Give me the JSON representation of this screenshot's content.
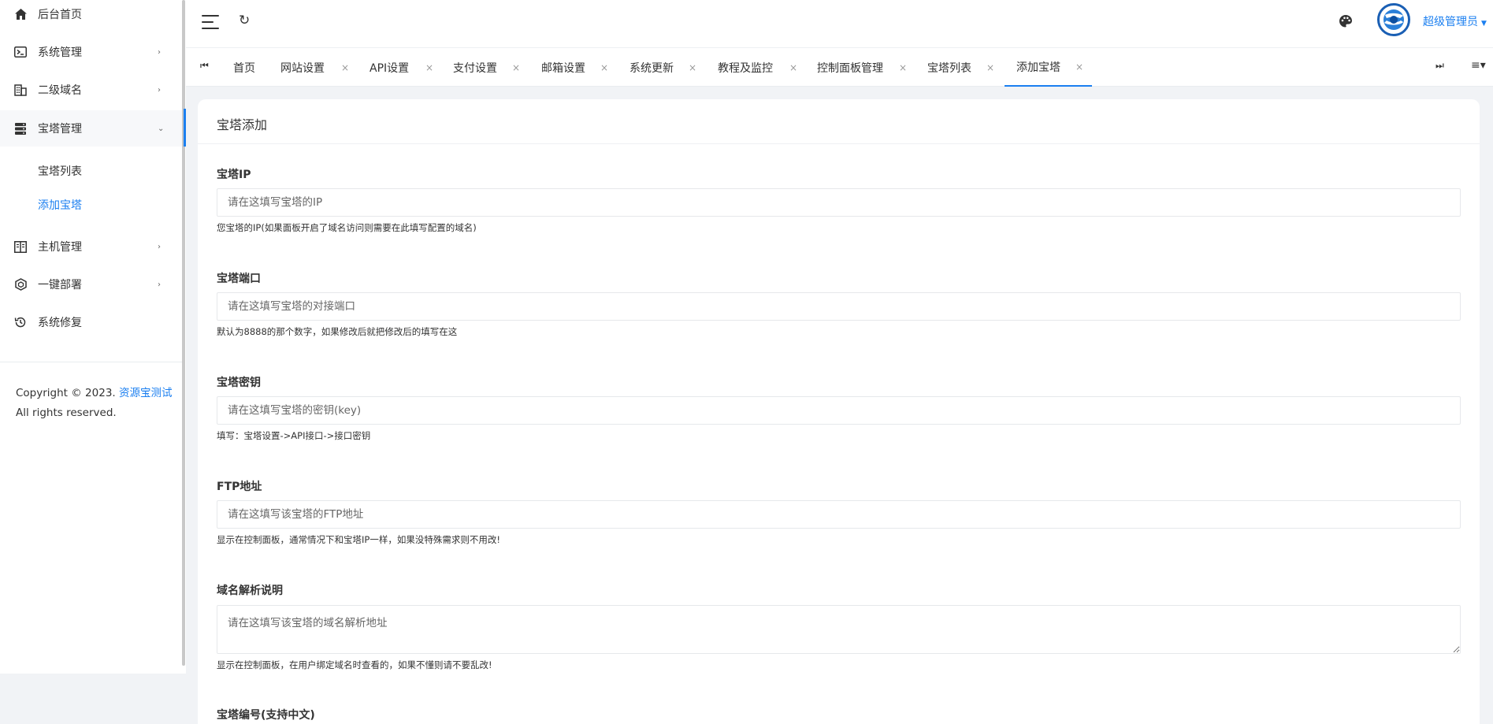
{
  "sidebar": {
    "items": [
      {
        "label": "后台首页",
        "icon": "home-icon"
      },
      {
        "label": "系统管理",
        "icon": "terminal-icon",
        "chevron": "›"
      },
      {
        "label": "二级域名",
        "icon": "building-icon",
        "chevron": "›"
      },
      {
        "label": "宝塔管理",
        "icon": "server-icon",
        "chevron": "⌄"
      },
      {
        "label": "主机管理",
        "icon": "columns-icon",
        "chevron": "›"
      },
      {
        "label": "一键部署",
        "icon": "hexagon-icon",
        "chevron": "›"
      },
      {
        "label": "系统修复",
        "icon": "history-icon"
      }
    ],
    "subitems": [
      {
        "label": "宝塔列表"
      },
      {
        "label": "添加宝塔"
      }
    ],
    "copyright_prefix": "Copyright © 2023. ",
    "copyright_link": "资源宝测试",
    "copyright_suffix": "All rights reserved."
  },
  "header": {
    "user": "超级管理员",
    "caret": "▼",
    "refresh": "↻"
  },
  "tabs": {
    "first": "⏮",
    "last": "⏭",
    "menu": "≡▾",
    "close": "×",
    "items": [
      {
        "label": "首页"
      },
      {
        "label": "网站设置"
      },
      {
        "label": "API设置"
      },
      {
        "label": "支付设置"
      },
      {
        "label": "邮箱设置"
      },
      {
        "label": "系统更新"
      },
      {
        "label": "教程及监控"
      },
      {
        "label": "控制面板管理"
      },
      {
        "label": "宝塔列表"
      },
      {
        "label": "添加宝塔"
      }
    ]
  },
  "form": {
    "title": "宝塔添加",
    "fields": [
      {
        "label": "宝塔IP",
        "placeholder": "请在这填写宝塔的IP",
        "help": "您宝塔的IP(如果面板开启了域名访问则需要在此填写配置的域名)"
      },
      {
        "label": "宝塔端口",
        "placeholder": "请在这填写宝塔的对接端口",
        "help": "默认为8888的那个数字，如果修改后就把修改后的填写在这"
      },
      {
        "label": "宝塔密钥",
        "placeholder": "请在这填写宝塔的密钥(key)",
        "help": "填写：宝塔设置->API接口->接口密钥"
      },
      {
        "label": "FTP地址",
        "placeholder": "请在这填写该宝塔的FTP地址",
        "help": "显示在控制面板，通常情况下和宝塔IP一样，如果没特殊需求则不用改!"
      },
      {
        "label": "域名解析说明",
        "placeholder": "请在这填写该宝塔的域名解析地址",
        "help": "显示在控制面板，在用户绑定域名时查看的，如果不懂则请不要乱改!"
      },
      {
        "label": "宝塔编号(支持中文)"
      }
    ]
  }
}
